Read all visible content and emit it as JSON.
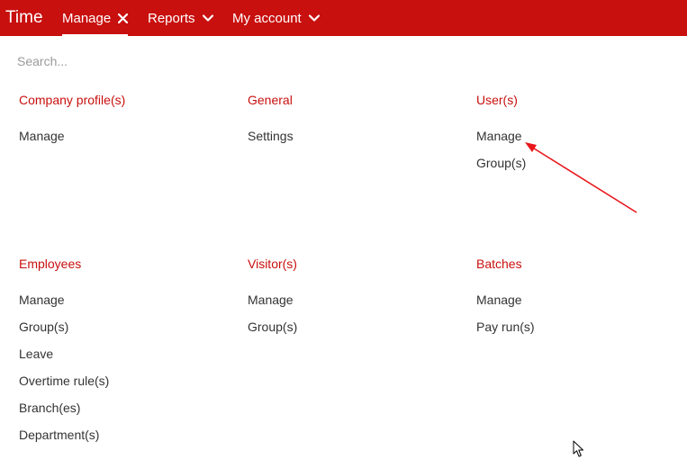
{
  "topbar": {
    "brand": "Time",
    "color": "#c8100e",
    "nav": [
      {
        "label": "Manage",
        "icon": "close-icon",
        "active": true
      },
      {
        "label": "Reports",
        "icon": "chevron-down-icon",
        "active": false
      },
      {
        "label": "My account",
        "icon": "chevron-down-icon",
        "active": false
      }
    ]
  },
  "search": {
    "placeholder": "Search...",
    "value": ""
  },
  "sections": [
    {
      "heading": "Company profile(s)",
      "items": [
        "Manage"
      ]
    },
    {
      "heading": "General",
      "items": [
        "Settings"
      ]
    },
    {
      "heading": "User(s)",
      "items": [
        "Manage",
        "Group(s)"
      ]
    },
    {
      "heading": "Employees",
      "items": [
        "Manage",
        "Group(s)",
        "Leave",
        "Overtime rule(s)",
        "Branch(es)",
        "Department(s)"
      ]
    },
    {
      "heading": "Visitor(s)",
      "items": [
        "Manage",
        "Group(s)"
      ]
    },
    {
      "heading": "Batches",
      "items": [
        "Manage",
        "Pay run(s)"
      ]
    }
  ],
  "annotation": {
    "type": "arrow",
    "points_to": "User(s) > Manage",
    "color": "#e8161b"
  }
}
